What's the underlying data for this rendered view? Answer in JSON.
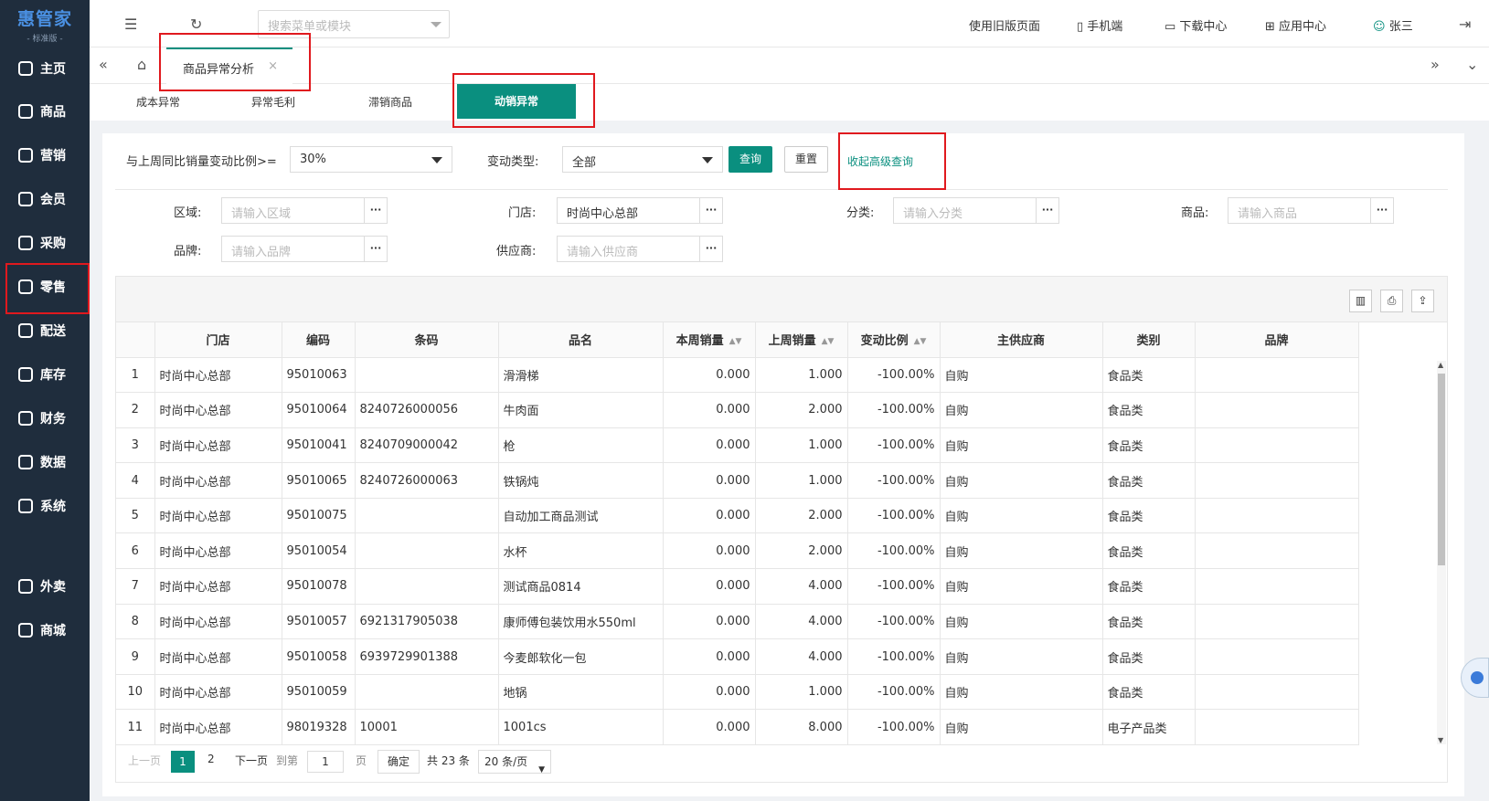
{
  "app": {
    "logo_main": "惠管家",
    "logo_sub": "- 标准版 -"
  },
  "sidebar": {
    "items": [
      {
        "label": "主页",
        "icon": "home-icon"
      },
      {
        "label": "商品",
        "icon": "box-icon"
      },
      {
        "label": "营销",
        "icon": "chart-icon"
      },
      {
        "label": "会员",
        "icon": "heart-icon"
      },
      {
        "label": "采购",
        "icon": "receipt-icon"
      },
      {
        "label": "零售",
        "icon": "bag-icon"
      },
      {
        "label": "配送",
        "icon": "truck-icon"
      },
      {
        "label": "库存",
        "icon": "inventory-icon"
      },
      {
        "label": "财务",
        "icon": "finance-icon"
      },
      {
        "label": "数据",
        "icon": "data-icon"
      },
      {
        "label": "系统",
        "icon": "settings-icon"
      },
      {
        "label": "外卖",
        "icon": "delivery-icon"
      },
      {
        "label": "商城",
        "icon": "mall-icon"
      }
    ]
  },
  "topbar": {
    "search_placeholder": "搜索菜单或模块",
    "links": [
      "使用旧版页面",
      "手机端",
      "下载中心",
      "应用中心",
      "张三"
    ]
  },
  "tabs": {
    "active": "商品异常分析",
    "close": "×"
  },
  "subtabs": [
    "成本异常",
    "异常毛利",
    "滞销商品",
    "动销异常"
  ],
  "filters": {
    "ratio_label": "与上周同比销量变动比例>=",
    "ratio_value": "30%",
    "type_label": "变动类型:",
    "type_value": "全部",
    "query_btn": "查询",
    "reset_btn": "重置",
    "advanced": "收起高级查询",
    "region_label": "区域:",
    "region_ph": "请输入区域",
    "store_label": "门店:",
    "store_value": "时尚中心总部",
    "category_label": "分类:",
    "category_ph": "请输入分类",
    "product_label": "商品:",
    "product_ph": "请输入商品",
    "brand_label": "品牌:",
    "brand_ph": "请输入品牌",
    "supplier_label": "供应商:",
    "supplier_ph": "请输入供应商",
    "dots": "···"
  },
  "table": {
    "headers": [
      "",
      "门店",
      "编码",
      "条码",
      "品名",
      "本周销量",
      "上周销量",
      "变动比例",
      "主供应商",
      "类别",
      "品牌"
    ],
    "rows": [
      [
        "1",
        "时尚中心总部",
        "95010063",
        "",
        "滑滑梯",
        "0.000",
        "1.000",
        "-100.00%",
        "自购",
        "食品类",
        ""
      ],
      [
        "2",
        "时尚中心总部",
        "95010064",
        "8240726000056",
        "牛肉面",
        "0.000",
        "2.000",
        "-100.00%",
        "自购",
        "食品类",
        ""
      ],
      [
        "3",
        "时尚中心总部",
        "95010041",
        "8240709000042",
        "枪",
        "0.000",
        "1.000",
        "-100.00%",
        "自购",
        "食品类",
        ""
      ],
      [
        "4",
        "时尚中心总部",
        "95010065",
        "8240726000063",
        "铁锅炖",
        "0.000",
        "1.000",
        "-100.00%",
        "自购",
        "食品类",
        ""
      ],
      [
        "5",
        "时尚中心总部",
        "95010075",
        "",
        "自动加工商品测试",
        "0.000",
        "2.000",
        "-100.00%",
        "自购",
        "食品类",
        ""
      ],
      [
        "6",
        "时尚中心总部",
        "95010054",
        "",
        "水杯",
        "0.000",
        "2.000",
        "-100.00%",
        "自购",
        "食品类",
        ""
      ],
      [
        "7",
        "时尚中心总部",
        "95010078",
        "",
        "测试商品0814",
        "0.000",
        "4.000",
        "-100.00%",
        "自购",
        "食品类",
        ""
      ],
      [
        "8",
        "时尚中心总部",
        "95010057",
        "6921317905038",
        "康师傅包装饮用水550ml",
        "0.000",
        "4.000",
        "-100.00%",
        "自购",
        "食品类",
        ""
      ],
      [
        "9",
        "时尚中心总部",
        "95010058",
        "6939729901388",
        "今麦郎软化一包",
        "0.000",
        "4.000",
        "-100.00%",
        "自购",
        "食品类",
        ""
      ],
      [
        "10",
        "时尚中心总部",
        "95010059",
        "",
        "地锅",
        "0.000",
        "1.000",
        "-100.00%",
        "自购",
        "食品类",
        ""
      ],
      [
        "11",
        "时尚中心总部",
        "98019328",
        "10001",
        "1001cs",
        "0.000",
        "8.000",
        "-100.00%",
        "自购",
        "电子产品类",
        ""
      ]
    ]
  },
  "pager": {
    "prev": "上一页",
    "page1": "1",
    "page2": "2",
    "next": "下一页",
    "goto": "到第",
    "goto_value": "1",
    "page_unit": "页",
    "confirm": "确定",
    "total": "共 23 条",
    "per_page": "20 条/页"
  }
}
